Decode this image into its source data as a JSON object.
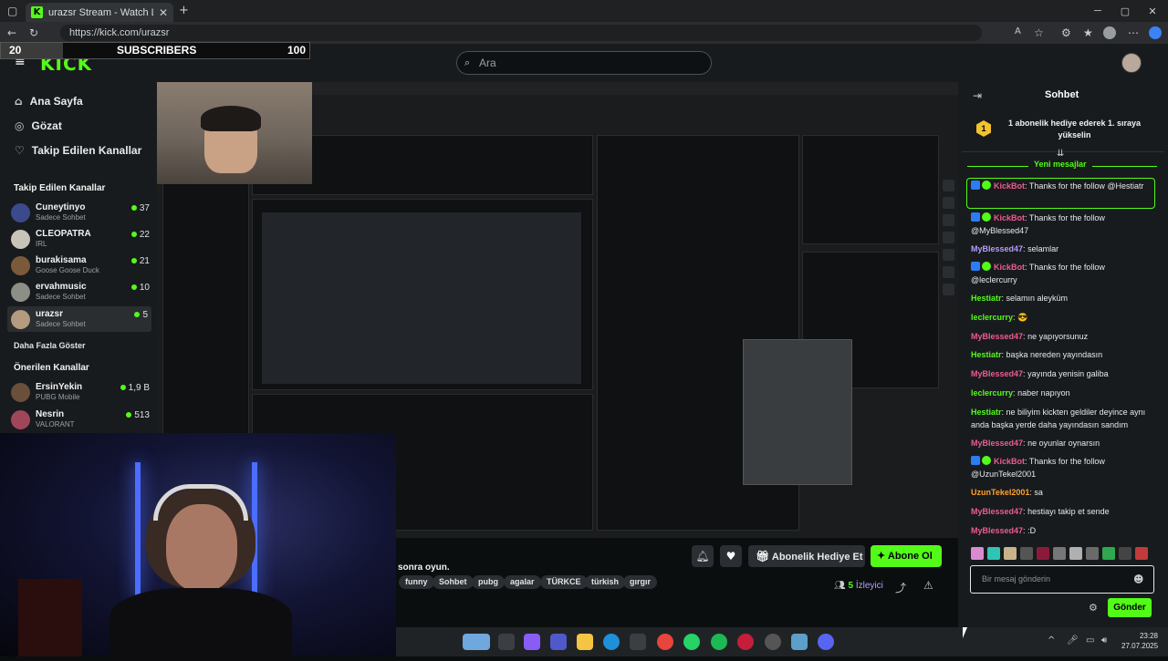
{
  "browser": {
    "tab_title": "urazsr Stream - Watch Live o",
    "url": "https://kick.com/urazsr"
  },
  "overlay": {
    "sub_current": "20",
    "sub_label": "SUBSCRIBERS",
    "sub_goal": "100"
  },
  "header": {
    "logo_text": "KICK",
    "search_placeholder": "Ara"
  },
  "sidebar": {
    "nav": [
      {
        "label": "Ana Sayfa",
        "icon": "home-icon"
      },
      {
        "label": "Gözat",
        "icon": "compass-icon"
      },
      {
        "label": "Takip Edilen Kanallar",
        "icon": "heart-icon"
      }
    ],
    "followed_title": "Takip Edilen Kanallar",
    "followed": [
      {
        "name": "Cuneytinyo",
        "sub": "Sadece Sohbet",
        "count": "37"
      },
      {
        "name": "CLEOPATRA",
        "sub": "IRL",
        "count": "22"
      },
      {
        "name": "burakisama",
        "sub": "Goose Goose Duck",
        "count": "21"
      },
      {
        "name": "ervahmusic",
        "sub": "Sadece Sohbet",
        "count": "10"
      },
      {
        "name": "urazsr",
        "sub": "Sadece Sohbet",
        "count": "5"
      }
    ],
    "show_more": "Daha Fazla Göster",
    "recommended_title": "Önerilen Kanallar",
    "recommended": [
      {
        "name": "ErsinYekin",
        "sub": "PUBG Mobile",
        "count": "1,9 B"
      },
      {
        "name": "Nesrin",
        "sub": "VALORANT",
        "count": "513"
      }
    ]
  },
  "stream_info": {
    "title_fragment": "sonra oyun.",
    "tags": [
      "funny",
      "Sohbet",
      "pubg",
      "agalar",
      "TÜRKCE",
      "türkish",
      "gırgır"
    ],
    "gift_button": "Abonelik Hediye Et",
    "subscribe_button": "Abone Ol",
    "viewers_count": "5",
    "viewers_label": "İzleyici"
  },
  "chat": {
    "title": "Sohbet",
    "pinned": "1 abonelik hediye ederek 1. sıraya yükselin",
    "new_messages": "Yeni mesajlar",
    "messages": [
      {
        "user": "KickBot",
        "text": "Thanks for the follow @Hestiatr",
        "color": "#ec5c8f",
        "bot": true
      },
      {
        "user": "KickBot",
        "text": "Thanks for the follow @MyBlessed47",
        "color": "#ec5c8f",
        "bot": true
      },
      {
        "user": "MyBlessed47",
        "text": "selamlar",
        "color": "#b69cff",
        "bot": false
      },
      {
        "user": "KickBot",
        "text": "Thanks for the follow @leclercurry",
        "color": "#ec5c8f",
        "bot": true
      },
      {
        "user": "Hestiatr",
        "text": "selamın aleyküm",
        "color": "#53fc18",
        "bot": false
      },
      {
        "user": "leclercurry",
        "text": "😎",
        "color": "#53fc18",
        "bot": false
      },
      {
        "user": "MyBlessed47",
        "text": "ne yapıyorsunuz",
        "color": "#ec5c8f",
        "bot": false
      },
      {
        "user": "Hestiatr",
        "text": "başka nereden yayındasın",
        "color": "#53fc18",
        "bot": false
      },
      {
        "user": "MyBlessed47",
        "text": "yayında yenisin galiba",
        "color": "#ec5c8f",
        "bot": false
      },
      {
        "user": "leclercurry",
        "text": "naber napıyon",
        "color": "#53fc18",
        "bot": false
      },
      {
        "user": "Hestiatr",
        "text": "ne biliyim kickten geldiler deyince aynı anda başka yerde daha yayındasın sandım",
        "color": "#53fc18",
        "bot": false
      },
      {
        "user": "MyBlessed47",
        "text": "ne oyunlar oynarsın",
        "color": "#ec5c8f",
        "bot": false
      },
      {
        "user": "KickBot",
        "text": "Thanks for the follow @UzunTekel2001",
        "color": "#ec5c8f",
        "bot": true
      },
      {
        "user": "UzunTekel2001",
        "text": "sa",
        "color": "#ffa02e",
        "bot": false
      },
      {
        "user": "MyBlessed47",
        "text": "hestiayı takip et sende",
        "color": "#ec5c8f",
        "bot": false
      },
      {
        "user": "MyBlessed47",
        "text": ":D",
        "color": "#ec5c8f",
        "bot": false
      }
    ],
    "input_placeholder": "Bir mesaj gönderin",
    "send_button": "Gönder"
  },
  "taskbar": {
    "time": "23:28",
    "date": "27.07.2025"
  },
  "colors": {
    "brand": "#53fc18",
    "background": "#0b0e0f",
    "panel": "#181b1d"
  }
}
